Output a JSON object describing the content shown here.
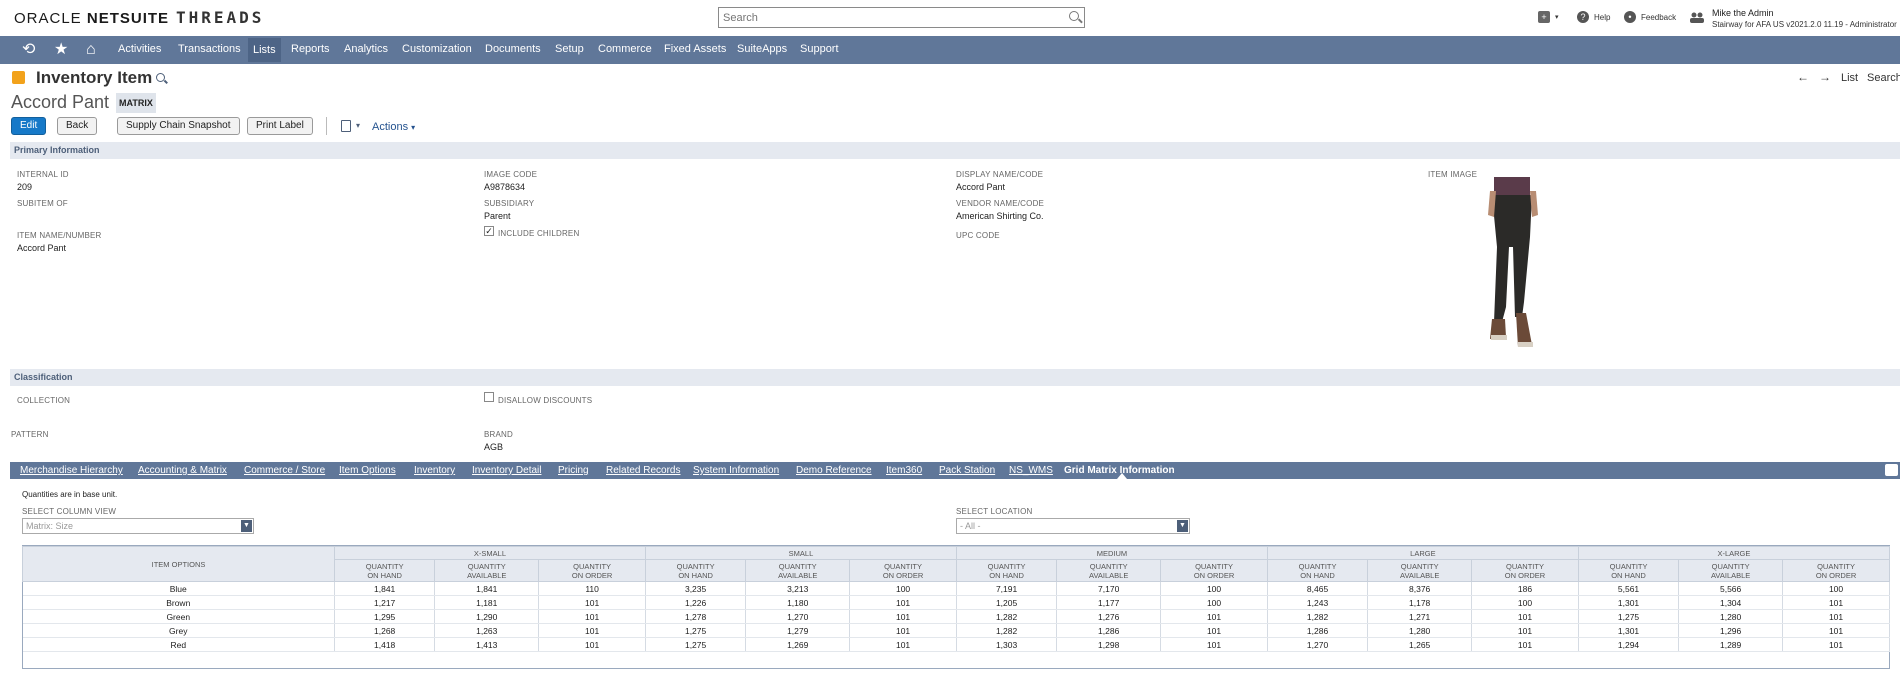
{
  "header": {
    "logo_oracle": "ORACLE",
    "logo_netsuite": "NETSUITE",
    "logo_threads": "THREADS",
    "search_placeholder": "Search",
    "help": "Help",
    "feedback": "Feedback",
    "user_name": "Mike the Admin",
    "user_role": "Stairway for AFA US v2021.2.0 11.19 - Administrator"
  },
  "nav": {
    "items": [
      "Activities",
      "Transactions",
      "Lists",
      "Reports",
      "Analytics",
      "Customization",
      "Documents",
      "Setup",
      "Commerce",
      "Fixed Assets",
      "SuiteApps",
      "Support"
    ],
    "active": "Lists"
  },
  "page": {
    "title": "Inventory Item",
    "record_name": "Accord Pant",
    "badge": "MATRIX",
    "right_nav": {
      "list": "List",
      "search": "Search"
    },
    "buttons": {
      "edit": "Edit",
      "back": "Back",
      "supply_chain": "Supply Chain Snapshot",
      "print_label": "Print Label",
      "actions": "Actions"
    }
  },
  "primary": {
    "section_title": "Primary Information",
    "internal_id_label": "INTERNAL ID",
    "internal_id": "209",
    "subitem_of_label": "SUBITEM OF",
    "item_name_label": "ITEM NAME/NUMBER",
    "item_name": "Accord Pant",
    "image_code_label": "IMAGE CODE",
    "image_code": "A9878634",
    "subsidiary_label": "SUBSIDIARY",
    "subsidiary": "Parent",
    "include_children_label": "INCLUDE CHILDREN",
    "display_name_label": "DISPLAY NAME/CODE",
    "display_name": "Accord Pant",
    "vendor_name_label": "VENDOR NAME/CODE",
    "vendor_name": "American Shirting Co.",
    "upc_label": "UPC CODE",
    "item_image_label": "ITEM IMAGE"
  },
  "classification": {
    "section_title": "Classification",
    "collection_label": "COLLECTION",
    "disallow_label": "DISALLOW DISCOUNTS",
    "pattern_label": "PATTERN",
    "brand_label": "BRAND",
    "brand": "AGB"
  },
  "tabs": [
    "Merchandise Hierarchy",
    "Accounting & Matrix",
    "Commerce / Store",
    "Item Options",
    "Inventory",
    "Inventory Detail",
    "Pricing",
    "Related Records",
    "System Information",
    "Demo Reference",
    "Item360",
    "Pack Station",
    "NS_WMS",
    "Grid Matrix Information"
  ],
  "grid_matrix": {
    "note": "Quantities are in base unit.",
    "column_view_label": "SELECT COLUMN VIEW",
    "column_view_value": "Matrix: Size",
    "location_label": "SELECT LOCATION",
    "location_value": "- All -",
    "item_options_header": "ITEM OPTIONS",
    "sizes": [
      "X-SMALL",
      "SMALL",
      "MEDIUM",
      "LARGE",
      "X-LARGE"
    ],
    "sub_headers": [
      [
        "QUANTITY",
        "ON HAND"
      ],
      [
        "QUANTITY",
        "AVAILABLE"
      ],
      [
        "QUANTITY",
        "ON ORDER"
      ]
    ],
    "rows": [
      {
        "option": "Blue",
        "values": [
          "1,841",
          "1,841",
          "110",
          "3,235",
          "3,213",
          "100",
          "7,191",
          "7,170",
          "100",
          "8,465",
          "8,376",
          "186",
          "5,561",
          "5,566",
          "100"
        ]
      },
      {
        "option": "Brown",
        "values": [
          "1,217",
          "1,181",
          "101",
          "1,226",
          "1,180",
          "101",
          "1,205",
          "1,177",
          "100",
          "1,243",
          "1,178",
          "100",
          "1,301",
          "1,304",
          "101"
        ]
      },
      {
        "option": "Green",
        "values": [
          "1,295",
          "1,290",
          "101",
          "1,278",
          "1,270",
          "101",
          "1,282",
          "1,276",
          "101",
          "1,282",
          "1,271",
          "101",
          "1,275",
          "1,280",
          "101"
        ]
      },
      {
        "option": "Grey",
        "values": [
          "1,268",
          "1,263",
          "101",
          "1,275",
          "1,279",
          "101",
          "1,282",
          "1,286",
          "101",
          "1,286",
          "1,280",
          "101",
          "1,301",
          "1,296",
          "101"
        ]
      },
      {
        "option": "Red",
        "values": [
          "1,418",
          "1,413",
          "101",
          "1,275",
          "1,269",
          "101",
          "1,303",
          "1,298",
          "101",
          "1,270",
          "1,265",
          "101",
          "1,294",
          "1,289",
          "101"
        ]
      }
    ]
  }
}
